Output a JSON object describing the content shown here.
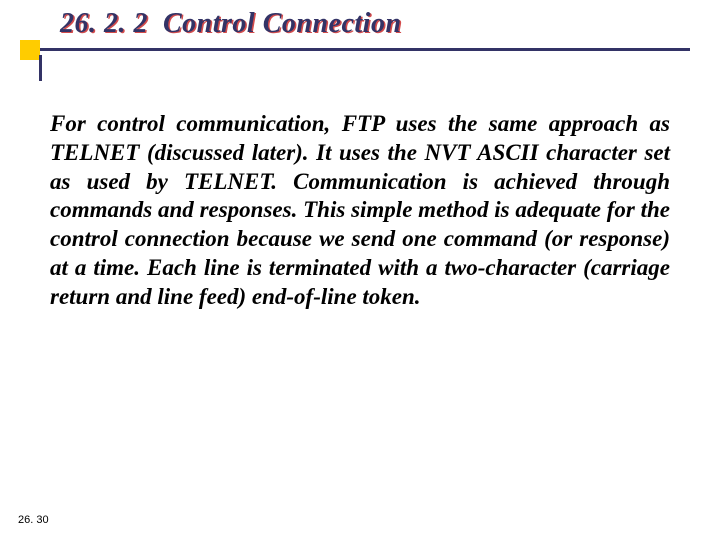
{
  "heading": {
    "number": "26. 2. 2",
    "title": "Control Connection"
  },
  "body": "For control communication, FTP uses the same approach as TELNET (discussed later). It uses the NVT ASCII character set as used by TELNET. Communication is achieved through commands and responses. This simple method is adequate for the control connection because we send one command (or response) at a time. Each line is terminated with a two-character (carriage return and line feed) end-of-line token.",
  "page_number": "26. 30"
}
